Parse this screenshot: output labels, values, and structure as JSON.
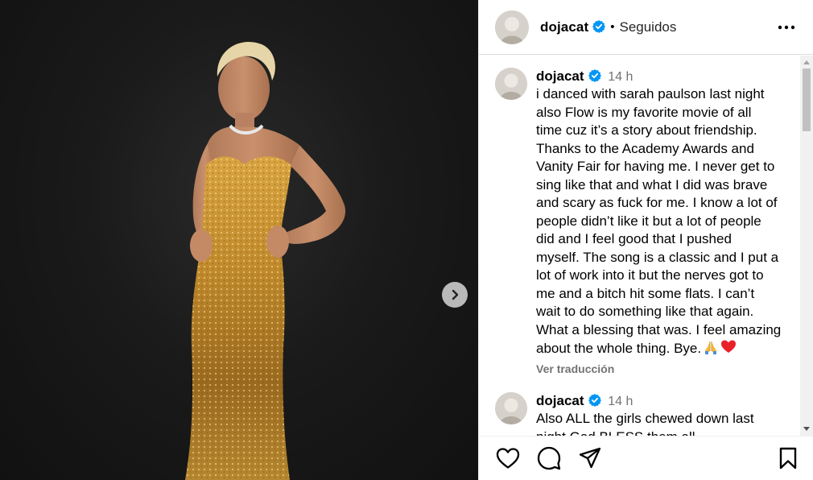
{
  "header": {
    "username": "dojacat",
    "separator": "•",
    "follow_state": "Seguidos"
  },
  "caption": {
    "username": "dojacat",
    "time": "14 h",
    "text": "i danced with sarah paulson last night\nalso Flow is my favorite movie of all\ntime cuz it’s a story about friendship.\nThanks to the Academy Awards and\nVanity Fair for having me. I never get to\nsing like that and what I did was brave\nand scary as fuck for me. I know a lot of\npeople didn’t like it but a lot of people\ndid and I feel good that I pushed\nmyself. The song is a classic and I put a\nlot of work into it but the nerves got to\nme and a bitch hit some flats. I can’t\nwait to do something like that again.\nWhat a blessing that was. I feel amazing\nabout the whole thing. Bye.",
    "translate_label": "Ver traducción"
  },
  "comment": {
    "username": "dojacat",
    "time": "14 h",
    "text": "Also ALL the girls chewed down last\nnight God BLESS them all"
  },
  "icons": {
    "verified": "verified-badge-icon",
    "more": "more-options-icon",
    "next": "chevron-right-icon",
    "like": "heart-icon",
    "comment": "comment-icon",
    "share": "send-icon",
    "save": "bookmark-icon",
    "emoji_1": "praying-hands-emoji",
    "emoji_2": "red-heart-emoji"
  },
  "colors": {
    "verified": "#0095f6",
    "muted_text": "#737373",
    "photo_background": "#1a1a1a",
    "dress_gold": "#b8862a"
  }
}
